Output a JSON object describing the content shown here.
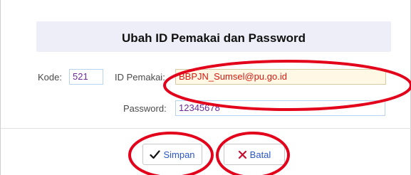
{
  "dialog": {
    "title": "Ubah ID Pemakai dan Password"
  },
  "form": {
    "kode_label": "Kode:",
    "kode_value": "521",
    "id_label": "ID Pemakai:",
    "id_value": "BBPJN_Sumsel@pu.go.id",
    "password_label": "Password:",
    "password_value": "12345678"
  },
  "buttons": {
    "save_label": "Simpan",
    "save_icon": "checkmark-icon",
    "cancel_label": "Batal",
    "cancel_icon": "close-x-icon"
  },
  "colors": {
    "header_bg": "#eeeef8",
    "annotation_red": "#e3001b",
    "id_text": "#d91a12",
    "value_text": "#6a2a9a",
    "button_text": "#2a56c6"
  }
}
